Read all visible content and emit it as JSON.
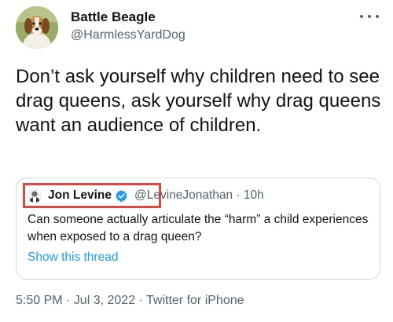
{
  "author": {
    "name": "Battle Beagle",
    "handle": "@HarmlessYardDog",
    "avatar_icon": "beagle-dog-photo"
  },
  "tweet": {
    "text": "Don’t ask yourself why children need to see drag queens, ask yourself why drag queens want an audience of children."
  },
  "quote": {
    "name": "Jon Levine",
    "handle_time": "@LevineJonathan · 10h",
    "text": "Can someone actually articulate the “harm” a child experiences when exposed to a drag queen?",
    "show_thread": "Show this thread",
    "highlight_color": "#e0463c",
    "verified_color": "#1d9bf0"
  },
  "meta": {
    "timestamp": "5:50 PM · Jul 3, 2022 · Twitter for iPhone"
  },
  "icons": {
    "more": "more-horizontal-icon",
    "verified": "verified-badge-icon"
  }
}
